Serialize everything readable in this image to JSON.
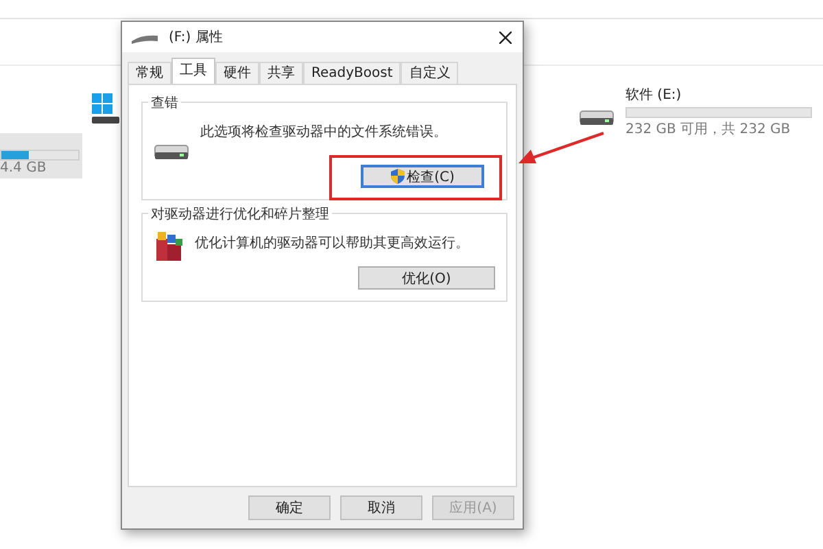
{
  "explorer": {
    "drives": [
      {
        "kind": "partial",
        "reading": "4.4 GB",
        "level": 0.35,
        "selected": true
      },
      {
        "kind": "full",
        "label": "软件 (E:)",
        "reading": "232 GB 可用，共 232 GB",
        "level": 0,
        "selected": false
      }
    ]
  },
  "dialog": {
    "title": "(F:) 属性",
    "tabs": [
      {
        "label": "常规",
        "selected": false
      },
      {
        "label": "工具",
        "selected": true
      },
      {
        "label": "硬件",
        "selected": false
      },
      {
        "label": "共享",
        "selected": false
      },
      {
        "label": "ReadyBoost",
        "selected": false
      },
      {
        "label": "自定义",
        "selected": false
      }
    ],
    "groups": [
      {
        "kind": "check",
        "title": "查错",
        "description": "此选项将检查驱动器中的文件系统错误。",
        "button": {
          "label": "检查(C)",
          "shield": true,
          "highlighted": true
        }
      },
      {
        "kind": "optimize",
        "title": "对驱动器进行优化和碎片整理",
        "description": "优化计算机的驱动器可以帮助其更高效运行。",
        "button": {
          "label": "优化(O)",
          "shield": false,
          "highlighted": false
        }
      }
    ],
    "buttons": [
      {
        "label": "确定",
        "disabled": false
      },
      {
        "label": "取消",
        "disabled": false
      },
      {
        "label": "应用(A)",
        "disabled": true
      }
    ]
  }
}
